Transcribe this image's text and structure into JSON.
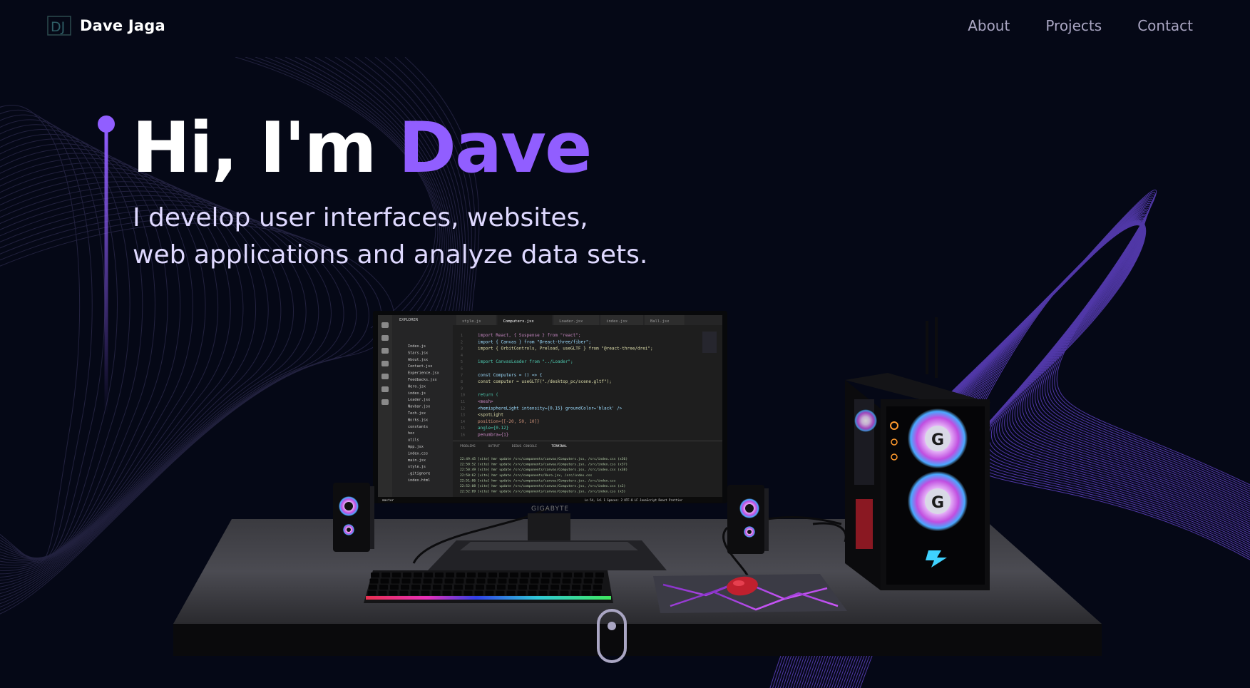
{
  "nav": {
    "logo_text": "DJ",
    "brand_name": "Dave Jaga",
    "links": [
      {
        "label": "About"
      },
      {
        "label": "Projects"
      },
      {
        "label": "Contact"
      }
    ]
  },
  "hero": {
    "title_prefix": "Hi, I'm ",
    "title_name": "Dave",
    "subtitle_line1": "I develop user interfaces, websites,",
    "subtitle_line2": "web applications and analyze data sets."
  },
  "monitor": {
    "brand": "GIGABYTE",
    "tabs": [
      "style.js",
      "Computers.jsx",
      "Loader.jsx",
      "index.jsx",
      "Ball.jsx"
    ],
    "explorer_title": "EXPLORER",
    "files": [
      "Index.js",
      "Stars.jsx",
      "About.jsx",
      "Contact.jsx",
      "Experience.jsx",
      "Feedbacks.jsx",
      "Hero.jsx",
      "index.js",
      "Loader.jsx",
      "Navbar.jsx",
      "Tech.jsx",
      "Works.jsx",
      "constants",
      "hoc",
      "utils",
      "App.jsx",
      "index.css",
      "main.jsx",
      "style.js",
      ".gitignore",
      "index.html"
    ],
    "code_lines": [
      "import React, { Suspense } from \"react\";",
      "import { Canvas } from \"@react-three/fiber\";",
      "import { OrbitControls, Preload, useGLTF } from \"@react-three/drei\";",
      "",
      "import CanvasLoader from \"../Loader\";",
      "",
      "const Computers = () => {",
      "  const computer = useGLTF(\"./desktop_pc/scene.gltf\");",
      "",
      "  return (",
      "    <mesh>",
      "      <hemisphereLight intensity={0.15} groundColor='black' />",
      "      <spotLight",
      "        position={[-20, 50, 10]}",
      "        angle={0.12}",
      "        penumbra={1}"
    ],
    "panel_tabs": [
      "PROBLEMS",
      "OUTPUT",
      "DEBUG CONSOLE",
      "TERMINAL"
    ],
    "terminal_lines": [
      "22:49:45 [vite] hmr update /src/components/canvas/Computers.jsx, /src/index.css (x36)",
      "22:50:52 [vite] hmr update /src/components/canvas/Computers.jsx, /src/index.css (x37)",
      "22:50:49 [vite] hmr update /src/components/canvas/Computers.jsx, /src/index.css (x38)",
      "22:50:62 [vite] hmr update /src/components/Hero.jsx, /src/index.css",
      "22:51:06 [vite] hmr update /src/components/canvas/Computers.jsx, /src/index.css",
      "22:52:08 [vite] hmr update /src/components/canvas/Computers.jsx, /src/index.css (x2)",
      "22:52:09 [vite] hmr update /src/components/canvas/Computers.jsx, /src/index.css (x3)"
    ],
    "status_left": "master",
    "status_right": "Ln 54, Col 1   Spaces: 2   UTF-8   LF   JavaScript React   Prettier"
  },
  "colors": {
    "background": "#050816",
    "accent": "#915eff",
    "nav_text": "#aaa6c3",
    "subtitle_text": "#dfd9ff"
  },
  "icons": {
    "logo": "dj-monogram-icon",
    "scroll": "mouse-scroll-icon",
    "hero_accent": "vertical-line-dot-icon"
  }
}
